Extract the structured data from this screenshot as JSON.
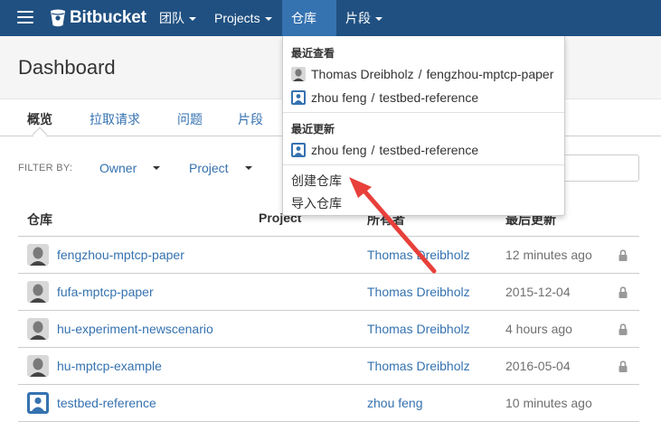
{
  "topbar": {
    "brand": "Bitbucket",
    "menus": [
      {
        "label": "团队"
      },
      {
        "label": "Projects"
      },
      {
        "label": "仓库"
      },
      {
        "label": "片段"
      }
    ]
  },
  "page": {
    "title": "Dashboard"
  },
  "tabs": [
    {
      "label": "概览"
    },
    {
      "label": "拉取请求"
    },
    {
      "label": "问题"
    },
    {
      "label": "片段"
    }
  ],
  "filter": {
    "label": "FILTER BY:",
    "owner": "Owner",
    "project": "Project"
  },
  "table": {
    "headers": {
      "repo": "仓库",
      "project": "Project",
      "owner": "所有者",
      "updated": "最后更新"
    },
    "rows": [
      {
        "repo": "fengzhou-mptcp-paper",
        "owner": "Thomas Dreibholz",
        "updated": "12 minutes ago",
        "avatar": "photo-avatar",
        "private": true
      },
      {
        "repo": "fufa-mptcp-paper",
        "owner": "Thomas Dreibholz",
        "updated": "2015-12-04",
        "avatar": "photo-avatar",
        "private": true
      },
      {
        "repo": "hu-experiment-newscenario",
        "owner": "Thomas Dreibholz",
        "updated": "4 hours ago",
        "avatar": "photo-avatar",
        "private": true
      },
      {
        "repo": "hu-mptcp-example",
        "owner": "Thomas Dreibholz",
        "updated": "2016-05-04",
        "avatar": "photo-avatar",
        "private": true
      },
      {
        "repo": "testbed-reference",
        "owner": "zhou feng",
        "updated": "10 minutes ago",
        "avatar": "default-user-avatar",
        "private": false
      }
    ]
  },
  "dropdown": {
    "recent_viewed_heading": "最近查看",
    "recent_viewed": [
      {
        "owner": "Thomas Dreibholz",
        "separator": "/",
        "repo": "fengzhou-mptcp-paper",
        "avatar": "photo-avatar"
      },
      {
        "owner": "zhou feng",
        "separator": "/",
        "repo": "testbed-reference",
        "avatar": "default-user-avatar"
      }
    ],
    "recent_updated_heading": "最近更新",
    "recent_updated": [
      {
        "owner": "zhou feng",
        "separator": "/",
        "repo": "testbed-reference",
        "avatar": "default-user-avatar"
      }
    ],
    "create_repo": "创建仓库",
    "import_repo": "导入仓库"
  },
  "colors": {
    "topbar": "#205081",
    "active_menu": "#3572b0",
    "link": "#3572b0",
    "annotation_arrow": "#e8403a"
  }
}
